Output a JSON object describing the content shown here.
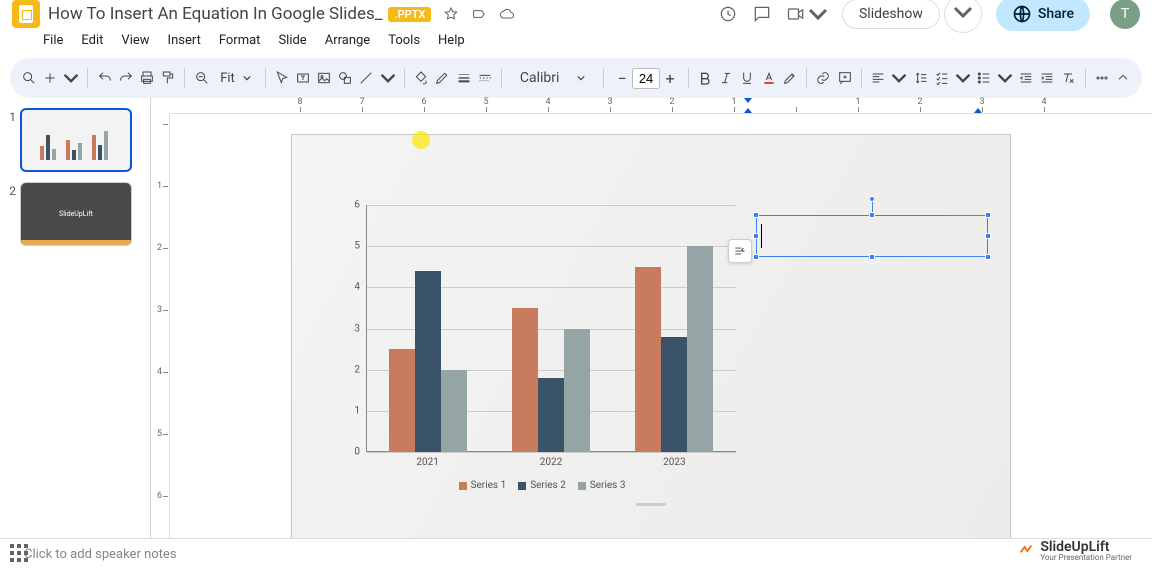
{
  "title": {
    "doc_name": "How To Insert An Equation In Google Slides_",
    "badge": ".PPTX"
  },
  "menu": [
    "File",
    "Edit",
    "View",
    "Insert",
    "Format",
    "Slide",
    "Arrange",
    "Tools",
    "Help"
  ],
  "toolbar": {
    "zoom": "Fit",
    "font": "Calibri",
    "font_size": "24"
  },
  "header_buttons": {
    "slideshow": "Slideshow",
    "share": "Share",
    "avatar": "T"
  },
  "ruler_h": [
    "8",
    "7",
    "6",
    "5",
    "4",
    "3",
    "2",
    "1",
    "",
    "1",
    "2",
    "3",
    "4"
  ],
  "ruler_v": [
    "",
    "1",
    "2",
    "3",
    "4",
    "5",
    "6"
  ],
  "thumbnails": [
    {
      "num": "1",
      "label": ""
    },
    {
      "num": "2",
      "label": "SlideUpLift"
    }
  ],
  "speaker_notes_placeholder": "Click to add speaker notes",
  "watermark": {
    "brand": "SlideUpLift",
    "tagline": "Your Presentation Partner"
  },
  "chart_data": {
    "type": "bar",
    "categories": [
      "2021",
      "2022",
      "2023"
    ],
    "series": [
      {
        "name": "Series 1",
        "color": "#c97b5e",
        "values": [
          2.5,
          3.5,
          4.5
        ]
      },
      {
        "name": "Series 2",
        "color": "#3b5368",
        "values": [
          4.4,
          1.8,
          2.8
        ]
      },
      {
        "name": "Series 3",
        "color": "#95a5a6",
        "values": [
          2.0,
          3.0,
          5.0
        ]
      }
    ],
    "ylim": [
      0,
      6
    ],
    "yticks": [
      0,
      1,
      2,
      3,
      4,
      5,
      6
    ],
    "title": "",
    "xlabel": "",
    "ylabel": ""
  }
}
